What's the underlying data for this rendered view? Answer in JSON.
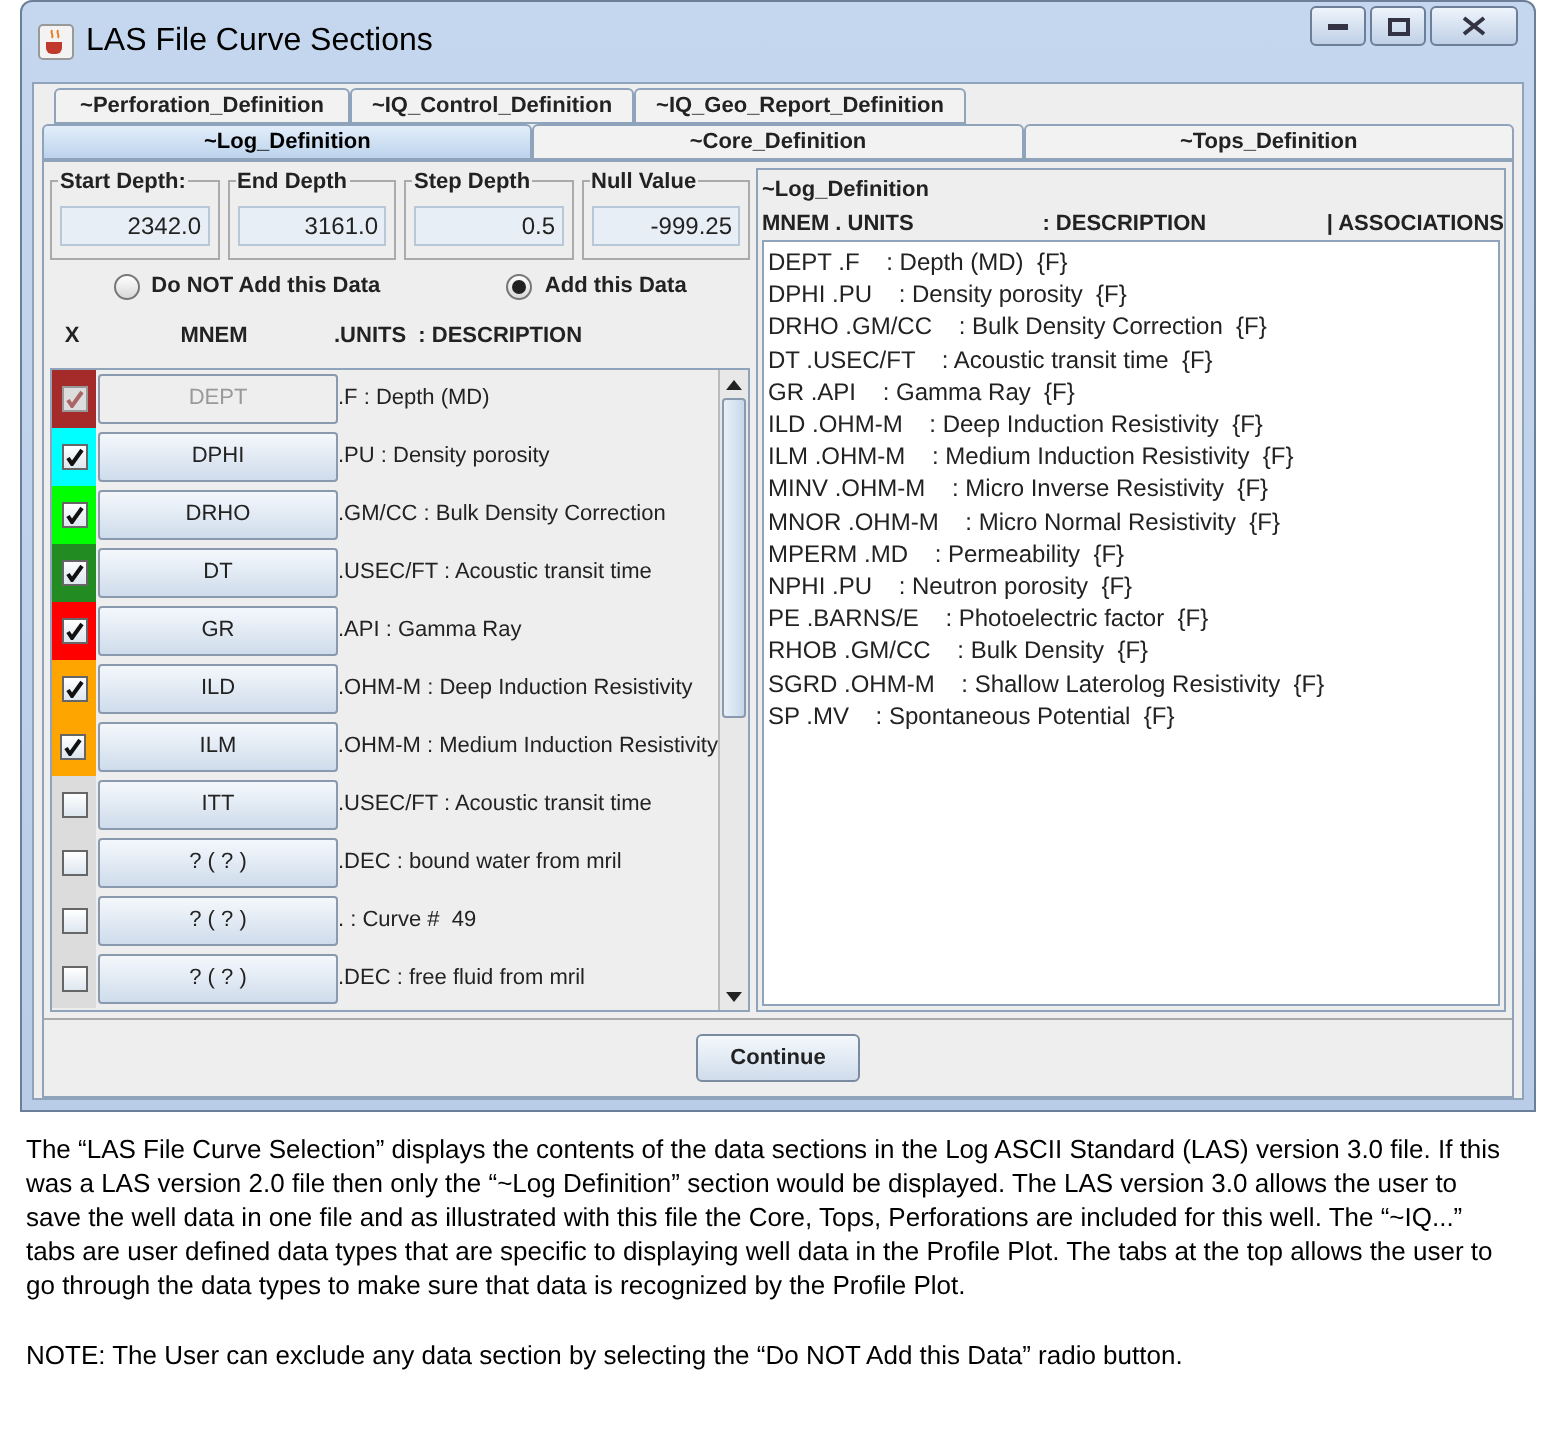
{
  "window": {
    "title": "LAS File Curve Sections"
  },
  "tab_rows": [
    [
      {
        "label": "~Perforation_Definition",
        "selected": false
      },
      {
        "label": "~IQ_Control_Definition",
        "selected": false
      },
      {
        "label": "~IQ_Geo_Report_Definition",
        "selected": false
      }
    ],
    [
      {
        "label": "~Log_Definition",
        "selected": true
      },
      {
        "label": "~Core_Definition",
        "selected": false
      },
      {
        "label": "~Tops_Definition",
        "selected": false
      }
    ]
  ],
  "fields": [
    {
      "label": "Start Depth:",
      "value": "2342.0"
    },
    {
      "label": "End Depth",
      "value": "3161.0"
    },
    {
      "label": "Step Depth",
      "value": "0.5"
    },
    {
      "label": "Null Value",
      "value": "-999.25"
    }
  ],
  "radios": [
    {
      "label": "Do NOT Add this Data",
      "selected": false
    },
    {
      "label": "Add this Data",
      "selected": true
    }
  ],
  "list_header": {
    "x": "X",
    "mnem": "MNEM",
    "units": ".UNITS  : DESCRIPTION"
  },
  "curves": [
    {
      "mnem": "DEPT",
      "description": ".F : Depth (MD)",
      "checked": true,
      "disabled": true,
      "color": "#a52a2a"
    },
    {
      "mnem": "DPHI",
      "description": ".PU : Density porosity",
      "checked": true,
      "disabled": false,
      "color": "#00ffff"
    },
    {
      "mnem": "DRHO",
      "description": ".GM/CC : Bulk Density Correction",
      "checked": true,
      "disabled": false,
      "color": "#00ff00"
    },
    {
      "mnem": "DT",
      "description": ".USEC/FT : Acoustic transit time",
      "checked": true,
      "disabled": false,
      "color": "#228b22"
    },
    {
      "mnem": "GR",
      "description": ".API : Gamma Ray",
      "checked": true,
      "disabled": false,
      "color": "#ff0000"
    },
    {
      "mnem": "ILD",
      "description": ".OHM-M : Deep Induction Resistivity",
      "checked": true,
      "disabled": false,
      "color": "#ffa500"
    },
    {
      "mnem": "ILM",
      "description": ".OHM-M : Medium Induction Resistivity",
      "checked": true,
      "disabled": false,
      "color": "#ffa500"
    },
    {
      "mnem": "ITT",
      "description": ".USEC/FT : Acoustic transit time",
      "checked": false,
      "disabled": false
    },
    {
      "mnem": "? ( ? )",
      "description": ".DEC : bound water from mril",
      "checked": false,
      "disabled": false
    },
    {
      "mnem": "? ( ? )",
      "description": ". : Curve #  49",
      "checked": false,
      "disabled": false
    },
    {
      "mnem": "? ( ? )",
      "description": ".DEC : free fluid from mril",
      "checked": false,
      "disabled": false
    }
  ],
  "definition": {
    "title": "~Log_Definition",
    "columns": [
      "MNEM . UNITS",
      ": DESCRIPTION",
      "| ASSOCIATIONS"
    ],
    "lines": [
      "DEPT .F    : Depth (MD)  {F}",
      "DPHI .PU    : Density porosity  {F}",
      "DRHO .GM/CC    : Bulk Density Correction  {F}",
      "DT .USEC/FT    : Acoustic transit time  {F}",
      "GR .API    : Gamma Ray  {F}",
      "ILD .OHM-M    : Deep Induction Resistivity  {F}",
      "ILM .OHM-M    : Medium Induction Resistivity  {F}",
      "MINV .OHM-M    : Micro Inverse Resistivity  {F}",
      "MNOR .OHM-M    : Micro Normal Resistivity  {F}",
      "MPERM .MD    : Permeability  {F}",
      "NPHI .PU    : Neutron porosity  {F}",
      "PE .BARNS/E    : Photoelectric factor  {F}",
      "RHOB .GM/CC    : Bulk Density  {F}",
      "SGRD .OHM-M    : Shallow Laterolog Resistivity  {F}",
      "SP .MV    : Spontaneous Potential  {F}"
    ]
  },
  "continue_button": "Continue",
  "caption": [
    "The “LAS File Curve Selection” displays the contents of the data sections in the Log ASCII Standard (LAS) version 3.0 file.  If this was a LAS version 2.0 file then only the “~Log Definition” section would be displayed.  The LAS version 3.0 allows the user to save the well data in one file and as illustrated with this file the Core, Tops, Perforations are included for this well.  The “~IQ...” tabs are user defined data types that are specific to displaying well data in the Profile Plot. The tabs at the top allows the user to go through the data types to make sure that data is recognized by the Profile Plot.",
    "NOTE: The User can exclude any data section by selecting the “Do NOT Add this Data” radio button."
  ]
}
